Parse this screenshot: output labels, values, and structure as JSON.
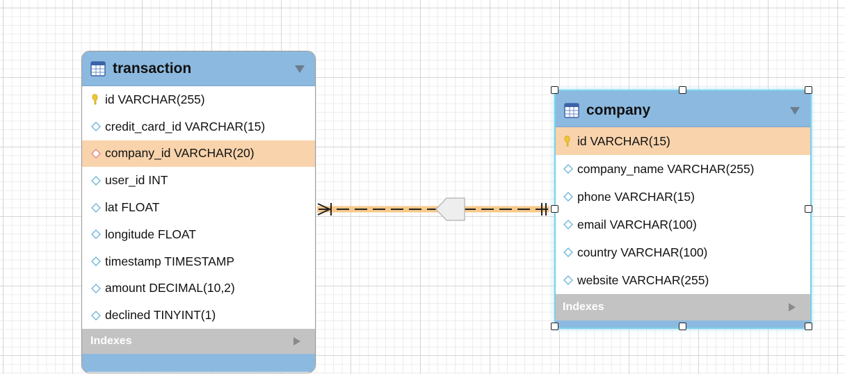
{
  "tables": {
    "transaction": {
      "title": "transaction",
      "columns": [
        {
          "label": "id VARCHAR(255)",
          "icon": "primary-key-icon",
          "selected": false
        },
        {
          "label": "credit_card_id VARCHAR(15)",
          "icon": "column-diamond-icon",
          "selected": false
        },
        {
          "label": "company_id VARCHAR(20)",
          "icon": "foreign-key-diamond-icon",
          "selected": true
        },
        {
          "label": "user_id INT",
          "icon": "column-diamond-icon",
          "selected": false
        },
        {
          "label": "lat FLOAT",
          "icon": "column-diamond-icon",
          "selected": false
        },
        {
          "label": "longitude FLOAT",
          "icon": "column-diamond-icon",
          "selected": false
        },
        {
          "label": "timestamp TIMESTAMP",
          "icon": "column-diamond-icon",
          "selected": false
        },
        {
          "label": "amount DECIMAL(10,2)",
          "icon": "column-diamond-icon",
          "selected": false
        },
        {
          "label": "declined TINYINT(1)",
          "icon": "column-diamond-icon",
          "selected": false
        }
      ],
      "indexes_label": "Indexes"
    },
    "company": {
      "title": "company",
      "columns": [
        {
          "label": "id VARCHAR(15)",
          "icon": "primary-key-icon",
          "selected": true
        },
        {
          "label": "company_name VARCHAR(255)",
          "icon": "column-diamond-icon",
          "selected": false
        },
        {
          "label": "phone VARCHAR(15)",
          "icon": "column-diamond-icon",
          "selected": false
        },
        {
          "label": "email VARCHAR(100)",
          "icon": "column-diamond-icon",
          "selected": false
        },
        {
          "label": "country VARCHAR(100)",
          "icon": "column-diamond-icon",
          "selected": false
        },
        {
          "label": "website VARCHAR(255)",
          "icon": "column-diamond-icon",
          "selected": false
        }
      ],
      "indexes_label": "Indexes"
    }
  },
  "relationship": {
    "from": "transaction.company_id",
    "to": "company.id",
    "type": "many-to-one",
    "highlight_color": "#f6c98a"
  },
  "colors": {
    "header": "#8cb9df",
    "selected_row": "#f8d3ac",
    "indexes_bar": "#c3c3c3",
    "selection_glow": "#7ccfe9",
    "key_icon": "#f2c62f",
    "column_diamond": "#6fb6d9",
    "fk_diamond": "#e08a8a"
  }
}
